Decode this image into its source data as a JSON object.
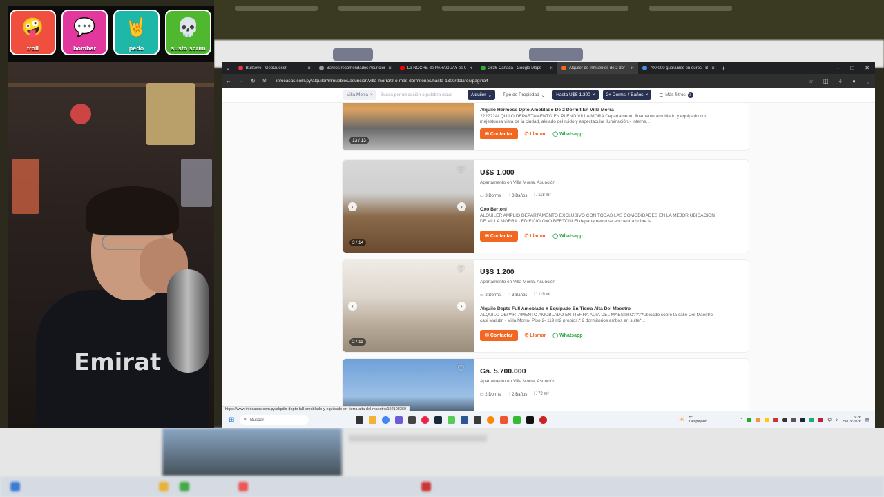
{
  "sounds": [
    {
      "label": "troll",
      "color": "#f04e3e",
      "icon": "🤪"
    },
    {
      "label": "bombar",
      "color": "#e2379c",
      "icon": "💬"
    },
    {
      "label": "pedo",
      "color": "#1fb8a8",
      "icon": "🤘"
    },
    {
      "label": "susto scrim",
      "color": "#4fb82f",
      "icon": "💀"
    }
  ],
  "webcam": {
    "shirt_text": "Emirat"
  },
  "browser": {
    "tabs": [
      {
        "title": "Bullseye - GeoGuessr",
        "color": "#e34"
      },
      {
        "title": "Barrios recomendados Asunción",
        "color": "#999"
      },
      {
        "title": "La NOCHE de PARAGUAY es UN",
        "color": "#f00"
      },
      {
        "title": "2636 Cañada - Google Maps",
        "color": "#3a3"
      },
      {
        "title": "Alquiler de inmuebles de 2 dor",
        "color": "#f26722"
      },
      {
        "title": "700 000 guaraníes en euros - B",
        "color": "#4a90e2"
      }
    ],
    "new_tab": "+",
    "url": "infocasas.com.py/alquiler/inmuebles/asuncion/villa-morra/2-o-mas-dormitorios/hasta-1300/dolares/pagina4",
    "filters": {
      "location": "Villa Morra",
      "search_placeholder": "Buscá por ubicación o palabra clave",
      "operation": "Alquiler",
      "property_type": "Tipo de Propiedad",
      "price": "Hasta U$S 1.300",
      "rooms": "2+ Dorms. / Baños",
      "more": "Más filtros",
      "more_count": "3"
    },
    "listings": [
      {
        "price": "",
        "location": "",
        "features": [],
        "title": "Alquilo Hermoso Dpto Amoblado De 2 Dormit En Villa Morra",
        "desc": "??????ALQUILO DEPARTAMENTO EN PLENO VILLA MORA Departamento finamente amoblado y equipado con majestuosa vista de la ciudad, alejado del ruido y espectacular iluminación.- Interne...",
        "photo_count": "13 / 13",
        "photo": "linear-gradient(180deg,#5a4a3a 0%, #c08a4a 40%, #d9a060 55%, #6a6a6a 75%, #bdbdbd 100%)"
      },
      {
        "price": "U$S 1.000",
        "location": "Apartamento en Villa Morra, Asunción",
        "features": [
          "3 Dorms.",
          "3 Baños",
          "118 m²"
        ],
        "title": "Oxo Bertoni",
        "desc": "ALQUILER AMPLIO DEPARTAMENTO EXCLUSIVO CON TODAS LAS COMODIDADES EN LA MEJOR UBICACIÓN DE VILLA MORRA - EDIFICIO OXO BERTONI.El departamento se encuentra sobre la...",
        "photo_count": "3 / 14",
        "photo": "linear-gradient(180deg,#d8d8d8 0%, #cfcfcf 35%, #8a6a4a 60%, #6a4a30 100%)"
      },
      {
        "price": "U$S 1.200",
        "location": "Apartamento en Villa Morra, Asunción",
        "features": [
          "2 Dorms.",
          "3 Baños",
          "119 m²"
        ],
        "title": "Alquilo Depto Full Amoblado Y Equipado En Tierra Alta Del Maestro",
        "desc": "ALQUILO DEPARTAMENTO AMOBLADO EN TIERRA ALTA DEL MAESTRO????Ubicado sobre la calle Del Maestro casi Malutin - Villa Morra- Piso 2- 119 m2 propios.* 2 dormitorios ambos en suite*...",
        "photo_count": "2 / 11",
        "photo": "linear-gradient(180deg,#f0ece6 0%, #ddd6cc 40%, #b8aa98 70%, #9a8c7a 100%)"
      },
      {
        "price": "Gs. 5.700.000",
        "location": "Apartamento en Villa Morra, Asunción",
        "features": [
          "2 Dorms.",
          "2 Baños",
          "72 m²"
        ],
        "title": "",
        "desc": "",
        "photo_count": "",
        "photo": "linear-gradient(180deg,#6fa0d8 0%, #9cc0e6 40%, #3a4a5a 60%, #2a3038 100%)"
      }
    ],
    "actions": {
      "contact": "Contactar",
      "call": "Llamar",
      "whatsapp": "Whatsapp"
    },
    "status_url": "https://www.infocasas.com.py/alquilo-depto-full-amoblado-y-equipado-en-tierra-alta-del-maestro/192103360",
    "taskbar": {
      "search": "Buscar",
      "weather_temp": "5°C",
      "weather_desc": "Despejado",
      "time": "5:26",
      "date": "29/03/2026"
    }
  }
}
